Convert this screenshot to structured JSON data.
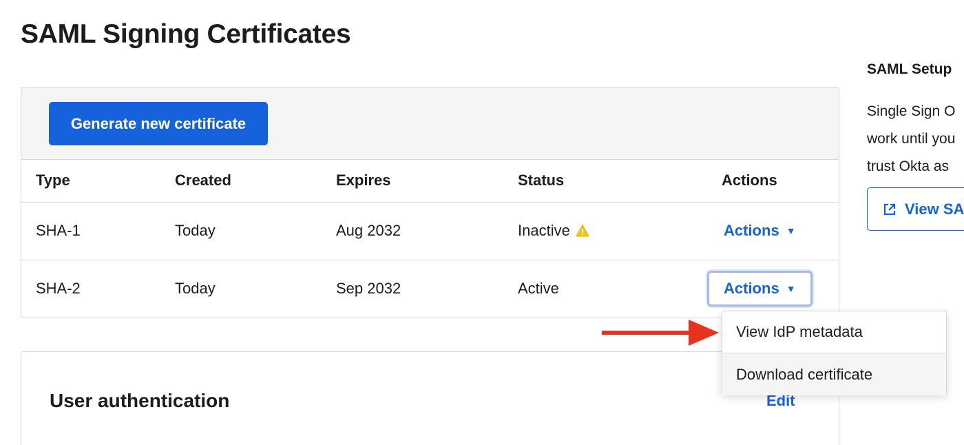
{
  "page": {
    "title": "SAML Signing Certificates"
  },
  "certificates": {
    "generate_button": "Generate new certificate",
    "columns": [
      "Type",
      "Created",
      "Expires",
      "Status",
      "Actions"
    ],
    "rows": [
      {
        "type": "SHA-1",
        "created": "Today",
        "expires": "Aug 2032",
        "status": "Inactive",
        "status_icon": "warning-icon",
        "actions": "Actions"
      },
      {
        "type": "SHA-2",
        "created": "Today",
        "expires": "Sep 2032",
        "status": "Active",
        "actions": "Actions"
      }
    ]
  },
  "dropdown": {
    "items": [
      "View IdP metadata",
      "Download certificate"
    ]
  },
  "user_auth": {
    "title": "User authentication",
    "edit": "Edit"
  },
  "sidebar": {
    "heading": "SAML Setup",
    "lines": [
      "Single Sign O",
      "work until you",
      "trust Okta as"
    ],
    "button": "View SA",
    "button_icon": "external-link-icon"
  },
  "colors": {
    "primary": "#1662dd",
    "warning": "#f5c518",
    "annotation_arrow": "#e8321e"
  }
}
